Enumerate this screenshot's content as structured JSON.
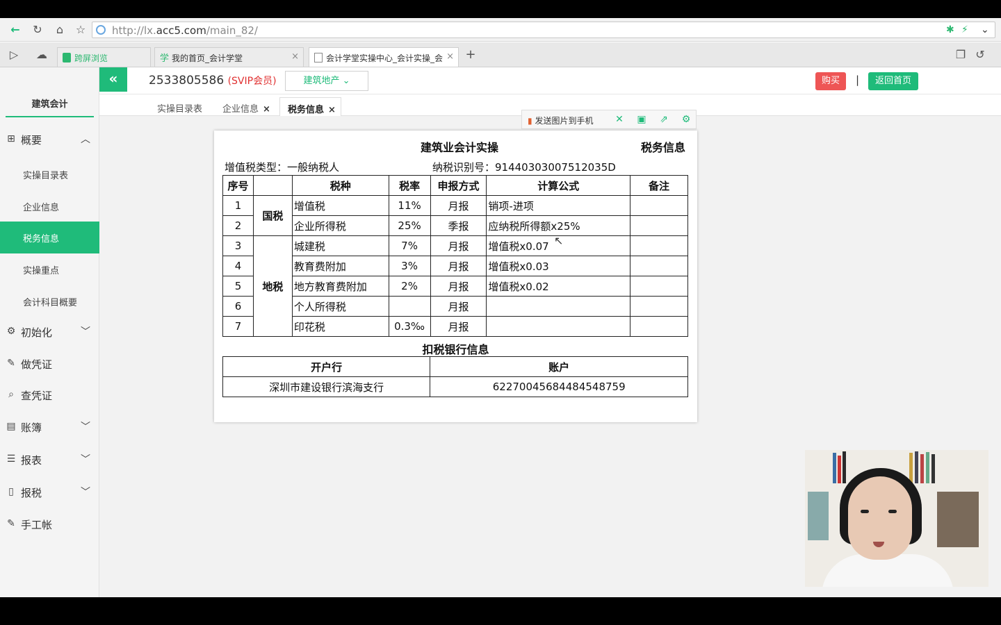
{
  "browser": {
    "url_prefix": "http://lx.",
    "url_domain": "acc5.com",
    "url_path": "/main_82/",
    "tabs": [
      {
        "label": "跨屏浏览"
      },
      {
        "label": "我的首页_会计学堂"
      },
      {
        "label": "会计学堂实操中心_会计实操_会"
      }
    ],
    "new_tab": "+"
  },
  "sidebar": {
    "brand": "建筑会计",
    "sections": [
      {
        "label": "概要"
      },
      {
        "label": "初始化"
      },
      {
        "label": "做凭证"
      },
      {
        "label": "查凭证"
      },
      {
        "label": "账簿"
      },
      {
        "label": "报表"
      },
      {
        "label": "报税"
      },
      {
        "label": "手工帐"
      }
    ],
    "sub_items": [
      {
        "label": "实操目录表"
      },
      {
        "label": "企业信息"
      },
      {
        "label": "税务信息"
      },
      {
        "label": "实操重点"
      },
      {
        "label": "会计科目概要"
      }
    ]
  },
  "header": {
    "collapse_icon": "«",
    "user_id": "2533805586",
    "vip": "(SVIP会员)",
    "industry": "建筑地产",
    "buy": "购买",
    "separator": "|",
    "home": "返回首页"
  },
  "page_tabs": [
    {
      "label": "实操目录表"
    },
    {
      "label": "企业信息",
      "close": "×"
    },
    {
      "label": "税务信息",
      "close": "×"
    }
  ],
  "doc_toolbar": {
    "send_label": "发送图片到手机"
  },
  "document": {
    "title": "建筑业会计实操",
    "right_title": "税务信息",
    "vat_type": "增值税类型：一般纳税人",
    "tax_id": "纳税识别号：91440303007512035D",
    "headers": [
      "序号",
      "",
      "税种",
      "税率",
      "申报方式",
      "计算公式",
      "备注"
    ],
    "group_national": "国税",
    "group_local": "地税",
    "rows": [
      {
        "no": "1",
        "tax": "增值税",
        "rate": "11%",
        "mode": "月报",
        "formula": "销项-进项",
        "note": ""
      },
      {
        "no": "2",
        "tax": "企业所得税",
        "rate": "25%",
        "mode": "季报",
        "formula": "应纳税所得额x25%",
        "note": ""
      },
      {
        "no": "3",
        "tax": "城建税",
        "rate": "7%",
        "mode": "月报",
        "formula": "增值税x0.07",
        "note": ""
      },
      {
        "no": "4",
        "tax": "教育费附加",
        "rate": "3%",
        "mode": "月报",
        "formula": "增值税x0.03",
        "note": ""
      },
      {
        "no": "5",
        "tax": "地方教育费附加",
        "rate": "2%",
        "mode": "月报",
        "formula": "增值税x0.02",
        "note": ""
      },
      {
        "no": "6",
        "tax": "个人所得税",
        "rate": "",
        "mode": "月报",
        "formula": "",
        "note": ""
      },
      {
        "no": "7",
        "tax": "印花税",
        "rate": "0.3‰",
        "mode": "月报",
        "formula": "",
        "note": ""
      }
    ],
    "bank_title": "扣税银行信息",
    "bank_headers": [
      "开户行",
      "账户"
    ],
    "bank_row": {
      "bank": "深圳市建设银行滨海支行",
      "account": "62270045684484548759"
    }
  },
  "colors": {
    "accent": "#1fbb7a",
    "buy": "#ee5555",
    "vip": "#e03030"
  }
}
